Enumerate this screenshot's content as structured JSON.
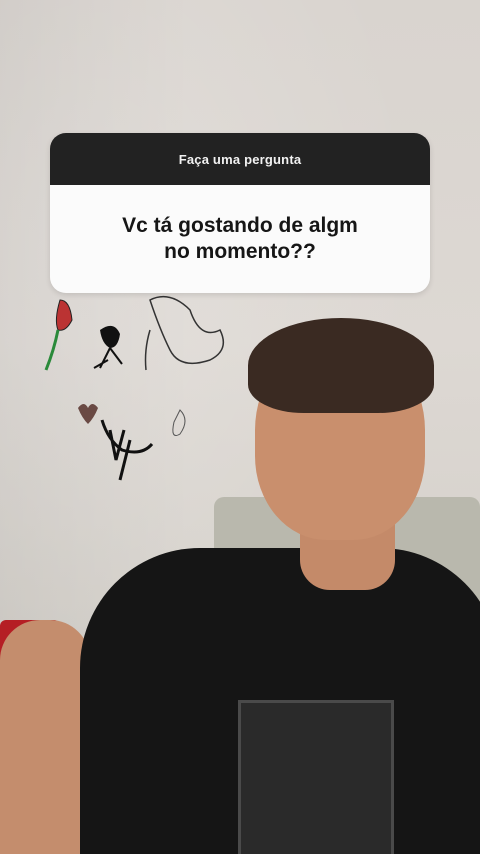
{
  "question_sticker": {
    "header": "Faça uma pergunta",
    "question": "Vc tá gostando de algm\nno momento??"
  },
  "colors": {
    "sticker_header_bg": "#222222",
    "sticker_body_bg": "#fbfbfb",
    "shirt": "#151515",
    "pillow": "#b51e24"
  }
}
